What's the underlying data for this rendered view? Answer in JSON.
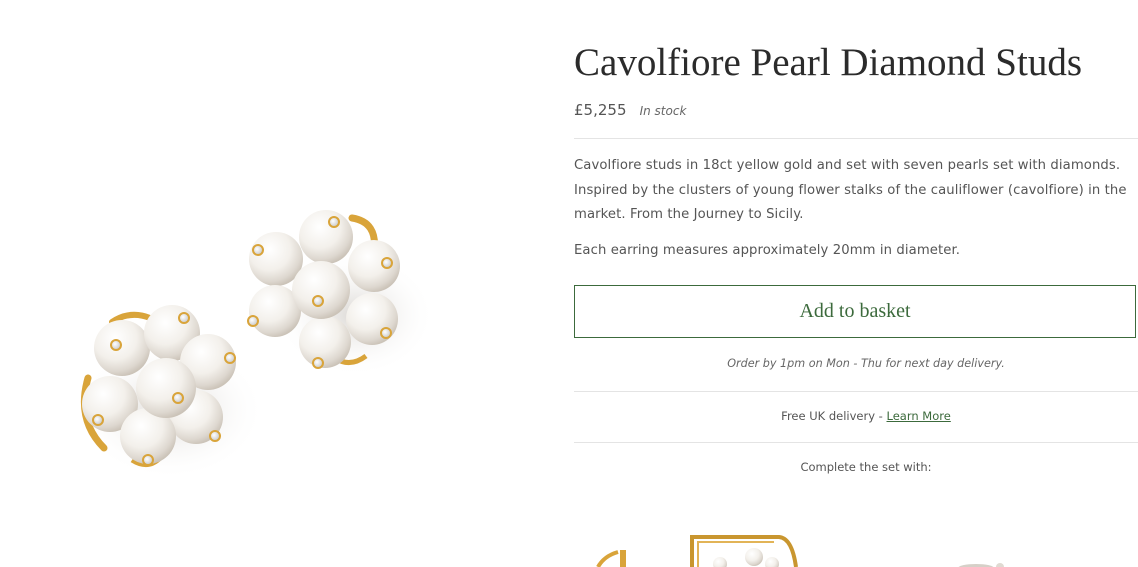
{
  "product": {
    "title": "Cavolfiore Pearl Diamond Studs",
    "price": "£5,255",
    "stock_status": "In stock",
    "description": "Cavolfiore studs in 18ct yellow gold and set with seven pearls set with diamonds. Inspired by the clusters of young flower stalks of the cauliflower (cavolfiore) in the market. From the Journey to Sicily.",
    "measurement": "Each earring measures approximately 20mm in diameter."
  },
  "actions": {
    "add_to_basket_label": "Add to basket"
  },
  "delivery": {
    "order_note": "Order by 1pm on Mon - Thu for next day delivery.",
    "free_delivery_text": "Free UK delivery - ",
    "learn_more_label": "Learn More"
  },
  "related": {
    "heading": "Complete the set with:"
  },
  "colors": {
    "accent_green": "#3c6a3c",
    "gold": "#d9a43a",
    "pearl": "#f4f1ec",
    "divider": "#e4e4e4"
  }
}
